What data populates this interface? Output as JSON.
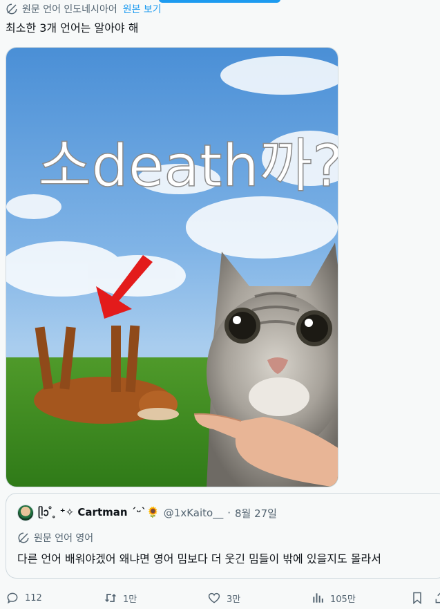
{
  "translation": {
    "source_label": "원문 언어 인도네시아어",
    "show_original": "원본 보기"
  },
  "post": {
    "text": "최소한 3개 언어는 알아야 해",
    "media": {
      "overlay_text": "소death까?"
    }
  },
  "quote": {
    "name": "ᥫᩣ ̊ ̥ ⁺✧ Cartman ˊᵕˋ🌻",
    "handle": "@1xKaito__",
    "separator": "·",
    "date": "8월 27일",
    "translation_label": "원문 언어 영어",
    "text": "다른 언어 배워야겠어 왜냐면 영어 밈보다 더 웃긴 밈들이 밖에 있을지도 몰라서"
  },
  "actions": {
    "reply": "112",
    "retweet": "1만",
    "like": "3만",
    "views": "105만"
  },
  "colors": {
    "accent": "#1d9bf0",
    "text": "#0f1419",
    "secondary": "#536471",
    "border": "#cfd9de",
    "background": "#f7f9f9"
  },
  "icons": [
    "translate-icon",
    "reply-icon",
    "retweet-icon",
    "like-icon",
    "views-icon",
    "bookmark-icon",
    "share-icon"
  ]
}
